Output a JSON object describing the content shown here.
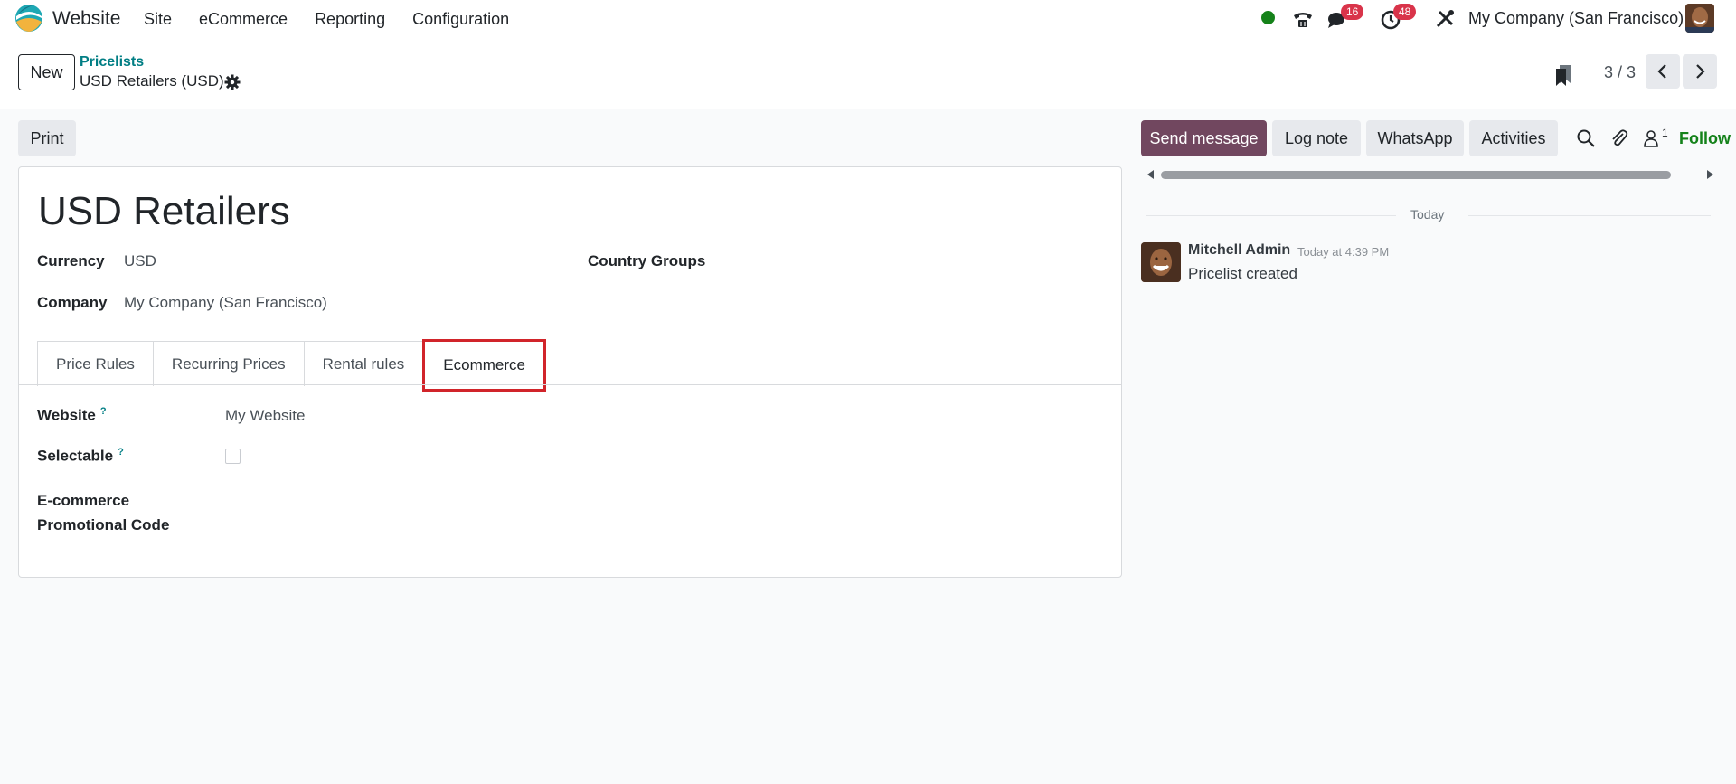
{
  "navbar": {
    "app_name": "Website",
    "menu": [
      "Site",
      "eCommerce",
      "Reporting",
      "Configuration"
    ],
    "messages_count": "16",
    "activities_count": "48",
    "company": "My Company (San Francisco)"
  },
  "control_panel": {
    "new_label": "New",
    "breadcrumb": "Pricelists",
    "record_title": "USD Retailers (USD)",
    "pager": "3 / 3"
  },
  "toolbar": {
    "print_label": "Print"
  },
  "form": {
    "title": "USD Retailers",
    "currency_label": "Currency",
    "currency_value": "USD",
    "company_label": "Company",
    "company_value": "My Company (San Francisco)",
    "country_groups_label": "Country Groups",
    "tabs": [
      "Price Rules",
      "Recurring Prices",
      "Rental rules",
      "Ecommerce"
    ],
    "active_tab": "Ecommerce",
    "website_label": "Website",
    "website_help": "?",
    "website_value": "My Website",
    "selectable_label": "Selectable",
    "selectable_help": "?",
    "selectable_checked": false,
    "promo_label_line1": "E-commerce",
    "promo_label_line2": "Promotional Code"
  },
  "chatter": {
    "send_message": "Send message",
    "log_note": "Log note",
    "whatsapp": "WhatsApp",
    "activities": "Activities",
    "followers_count": "1",
    "follow_label": "Follow",
    "date_separator": "Today",
    "messages": [
      {
        "author": "Mitchell Admin",
        "time": "Today at 4:39 PM",
        "body": "Pricelist created"
      }
    ]
  },
  "colors": {
    "primary": "#71475f",
    "link": "#017e84",
    "follow": "#15821a",
    "badge": "#d9344a",
    "highlight": "#d1242a"
  }
}
